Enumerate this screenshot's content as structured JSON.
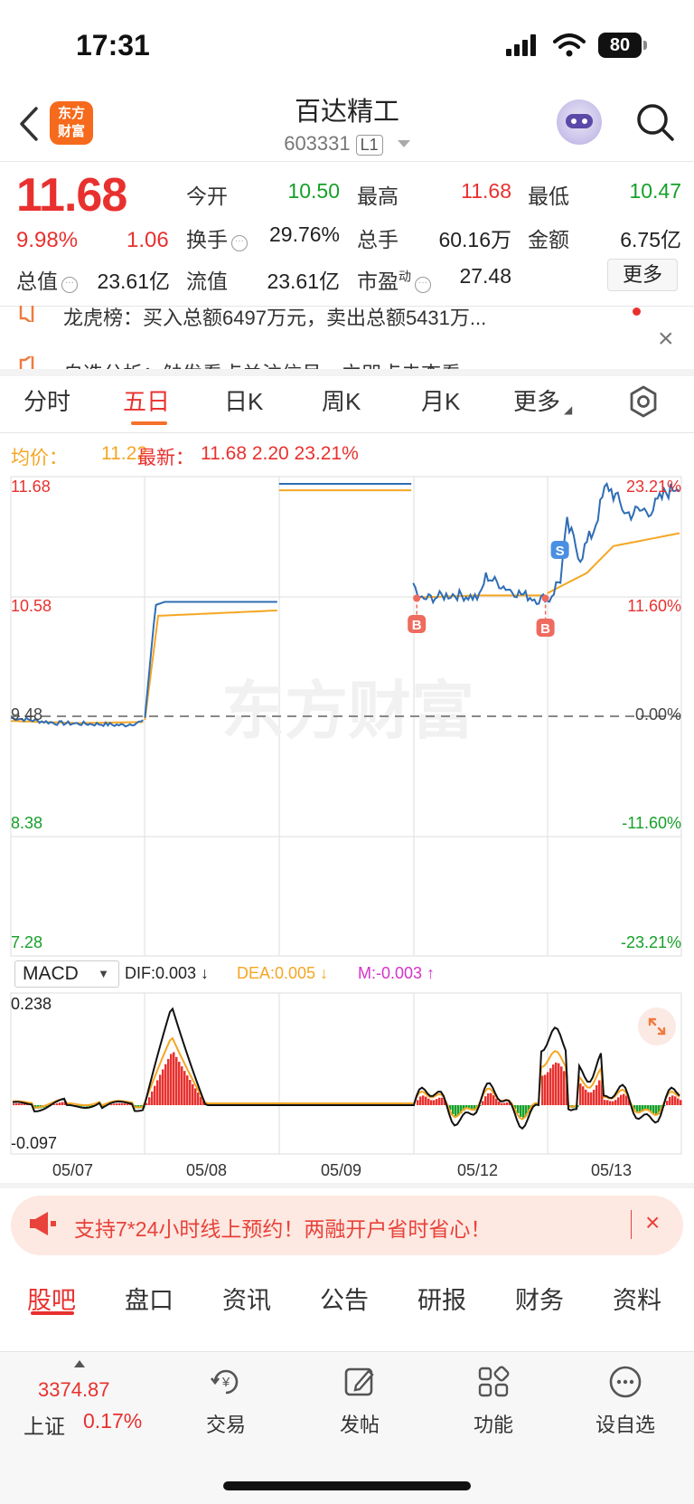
{
  "status_bar": {
    "time": "17:31",
    "battery": "80"
  },
  "header": {
    "logo_line1": "东方",
    "logo_line2": "财富",
    "stock_name": "百达精工",
    "stock_code": "603331",
    "level_badge": "L1"
  },
  "quote": {
    "price": "11.68",
    "change_pct": "9.98%",
    "change": "1.06",
    "rows": [
      {
        "l1": "今开",
        "v1": "10.50",
        "l2": "最高",
        "v2": "11.68",
        "l3": "最低",
        "v3": "10.47"
      },
      {
        "l1": "换手",
        "v1": "29.76%",
        "l2": "总手",
        "v2": "60.16万",
        "l3": "金额",
        "v3": "6.75亿"
      },
      {
        "l1": "总值",
        "v1": "23.61亿",
        "l2": "流值",
        "v2": "23.61亿",
        "l3": "市盈",
        "l3_sup": "动",
        "v3": "27.48"
      }
    ],
    "more_label": "更多"
  },
  "notices": [
    "龙虎榜：买入总额6497万元，卖出总额5431万...",
    "自选分析：触发看点关注信号，立即点击查看"
  ],
  "tabs": [
    "分时",
    "五日",
    "日K",
    "周K",
    "月K",
    "更多"
  ],
  "legend": {
    "avg_label": "均价：",
    "avg_value": "11.22",
    "latest_label": "最新：",
    "latest_values": "11.68  2.20  23.21%"
  },
  "chart_data": {
    "type": "line",
    "y_axis_left": [
      "11.68",
      "10.58",
      "9.48",
      "8.38",
      "7.28"
    ],
    "y_axis_right": [
      "23.21%",
      "11.60%",
      "0.00%",
      "-11.60%",
      "-23.21%"
    ],
    "ylim": [
      7.28,
      11.68
    ],
    "prev_close": 9.48,
    "days": [
      "05/07",
      "05/08",
      "05/09",
      "05/12",
      "05/13"
    ],
    "series": [
      {
        "name": "最新",
        "color": "#2f6db5"
      },
      {
        "name": "均价",
        "color": "#f5a623"
      }
    ],
    "markers": [
      {
        "label": "B",
        "day": "05/12",
        "price": 10.58
      },
      {
        "label": "B",
        "day": "05/12",
        "price": 10.58
      },
      {
        "label": "S",
        "day": "05/13",
        "price": 10.75
      }
    ],
    "watermark": "东方财富"
  },
  "macd": {
    "selector": "MACD",
    "dif": "DIF:0.003 ↓",
    "dea": "DEA:0.005 ↓",
    "m": "M:-0.003 ↑",
    "ymax": "0.238",
    "ymin": "-0.097"
  },
  "banner": {
    "text": "支持7*24小时线上预约！两融开户省时省心！"
  },
  "bottom_tabs": [
    "股吧",
    "盘口",
    "资讯",
    "公告",
    "研报",
    "财务",
    "资料"
  ],
  "footer": {
    "index_value": "3374.87",
    "index_name": "上证",
    "index_pct": "0.17%",
    "items": [
      "交易",
      "发帖",
      "功能",
      "设自选"
    ]
  }
}
